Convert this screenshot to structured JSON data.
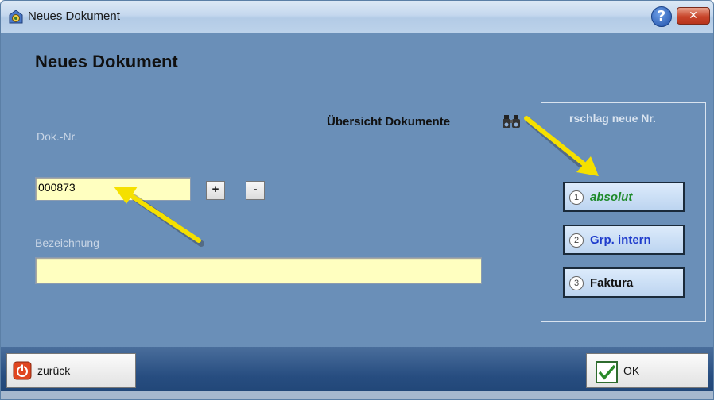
{
  "window": {
    "title": "Neues Dokument"
  },
  "heading": "Neues Dokument",
  "doc_nr": {
    "label": "Dok.-Nr.",
    "value": "000873",
    "plus": "+",
    "minus": "-"
  },
  "description": {
    "label": "Bezeichnung",
    "value": ""
  },
  "overview_link": "Übersicht Dokumente",
  "suggestion_group": {
    "title": "rschlag neue Nr.",
    "options": [
      {
        "num": "1",
        "label": "absolut",
        "color": "#1e8a2a",
        "italic": true
      },
      {
        "num": "2",
        "label": "Grp. intern",
        "color": "#1f3ccc",
        "italic": false
      },
      {
        "num": "3",
        "label": "Faktura",
        "color": "#111111",
        "italic": false
      }
    ]
  },
  "footer": {
    "back_label": "zurück",
    "ok_label": "OK"
  },
  "icons": {
    "app": "app-globe-icon",
    "help": "help-icon",
    "close": "close-icon",
    "binoculars": "binoculars-icon",
    "back": "power-icon",
    "ok": "checkmark-icon"
  },
  "colors": {
    "field_bg": "#ffffc0",
    "content_bg": "#6a8fb8",
    "footer_bg": "#274d80",
    "arrow": "#f5e000"
  }
}
